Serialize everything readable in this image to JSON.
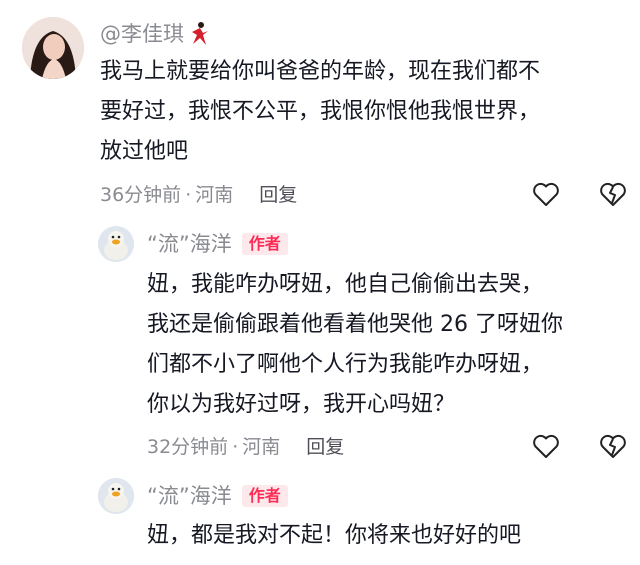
{
  "comments": [
    {
      "username": "@李佳琪",
      "lines": [
        "我马上就要给你叫爸爸的年龄，现在我们都不",
        "要好过，我恨不公平，我恨你恨他我恨世界，",
        "放过他吧"
      ],
      "time": "36分钟前",
      "separator": "·",
      "location": "河南",
      "reply_label": "回复"
    },
    {
      "username": "“流”海洋",
      "badge": "作者",
      "lines": [
        "妞，我能咋办呀妞，他自己偷偷出去哭，",
        "我还是偷偷跟着他看着他哭他 26 了呀妞你",
        "们都不小了啊他个人行为我能咋办呀妞，",
        "你以为我好过呀，我开心吗妞？"
      ],
      "time": "32分钟前",
      "separator": "·",
      "location": "河南",
      "reply_label": "回复"
    },
    {
      "username": "“流”海洋",
      "badge": "作者",
      "lines": [
        "妞，都是我对不起！你将来也好好的吧"
      ]
    }
  ],
  "icons": {
    "like": "heart-outline-icon",
    "dislike": "broken-heart-icon"
  },
  "colors": {
    "text": "#161823",
    "secondary": "#8a8b91",
    "badge_bg": "#fde9ec",
    "badge_text": "#fe2c55"
  }
}
